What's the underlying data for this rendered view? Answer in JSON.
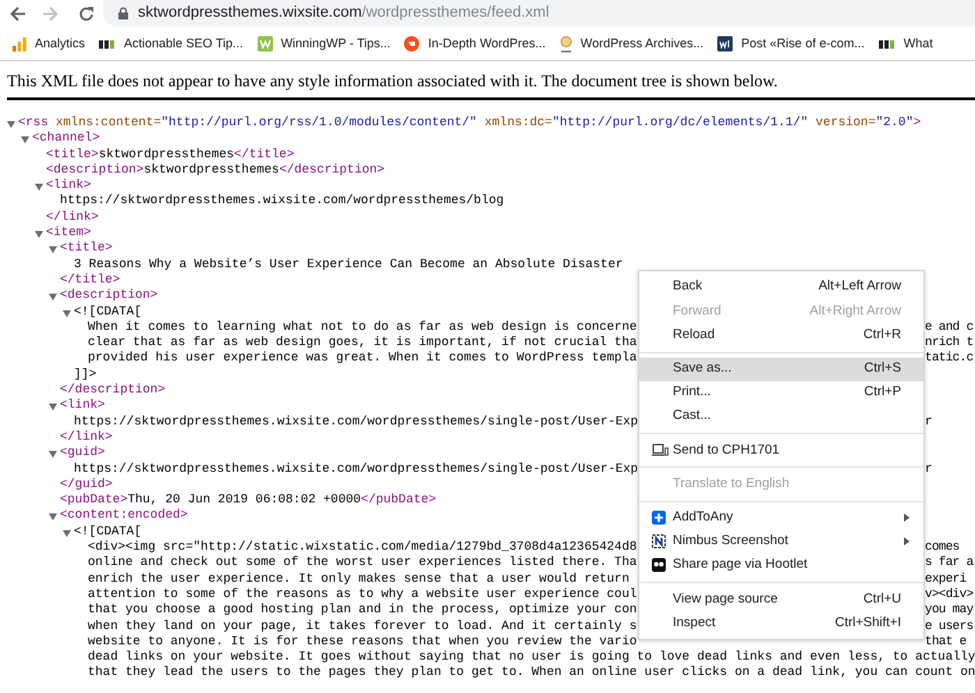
{
  "toolbar": {
    "url_host": "sktwordpressthemes.wixsite.com",
    "url_path": "/wordpressthemes/feed.xml",
    "forward_disabled": true
  },
  "bookmarks": [
    {
      "label": "Analytics",
      "kind": "bars"
    },
    {
      "label": "Actionable SEO Tip...",
      "kind": "sej"
    },
    {
      "label": "WinningWP - Tips...",
      "kind": "square-green"
    },
    {
      "label": "In-Depth WordPres...",
      "kind": "circle-orange"
    },
    {
      "label": "WordPress Archives...",
      "kind": "badge"
    },
    {
      "label": "Post «Rise of e-com...",
      "kind": "square-navy"
    },
    {
      "label": "What",
      "kind": "sej"
    }
  ],
  "notice": "This XML file does not appear to have any style information associated with it. The document tree is shown below.",
  "tree": [
    {
      "expanded": true,
      "parts": [
        {
          "kind": "tag",
          "text": "<rss"
        },
        {
          "kind": "attr",
          "text": " xmlns:content="
        },
        {
          "kind": "value",
          "text": "\"http://purl.org/rss/1.0/modules/content/\""
        },
        {
          "kind": "attr",
          "text": " xmlns:dc="
        },
        {
          "kind": "value",
          "text": "\"http://purl.org/dc/elements/1.1/\""
        },
        {
          "kind": "attr",
          "text": " version="
        },
        {
          "kind": "value",
          "text": "\"2.0\""
        },
        {
          "kind": "tag",
          "text": ">"
        }
      ],
      "children": [
        {
          "expanded": true,
          "parts": [
            {
              "kind": "tag",
              "text": "<channel>"
            }
          ],
          "children": [
            {
              "parts": [
                {
                  "kind": "tag",
                  "text": "<title>"
                },
                {
                  "kind": "text",
                  "text": "sktwordpressthemes"
                },
                {
                  "kind": "tag",
                  "text": "</title>"
                }
              ]
            },
            {
              "parts": [
                {
                  "kind": "tag",
                  "text": "<description>"
                },
                {
                  "kind": "text",
                  "text": "sktwordpressthemes"
                },
                {
                  "kind": "tag",
                  "text": "</description>"
                }
              ]
            },
            {
              "expanded": true,
              "parts": [
                {
                  "kind": "tag",
                  "text": "<link>"
                }
              ],
              "close": "</link>",
              "children": [
                {
                  "parts": [
                    {
                      "kind": "text",
                      "text": "https://sktwordpressthemes.wixsite.com/wordpressthemes/blog"
                    }
                  ]
                }
              ]
            },
            {
              "expanded": true,
              "parts": [
                {
                  "kind": "tag",
                  "text": "<item>"
                }
              ],
              "children": [
                {
                  "expanded": true,
                  "parts": [
                    {
                      "kind": "tag",
                      "text": "<title>"
                    }
                  ],
                  "close": "</title>",
                  "children": [
                    {
                      "parts": [
                        {
                          "kind": "text",
                          "text": "3 Reasons Why a Website’s User Experience Can Become an Absolute Disaster"
                        }
                      ]
                    }
                  ]
                },
                {
                  "expanded": true,
                  "parts": [
                    {
                      "kind": "tag",
                      "text": "<description>"
                    }
                  ],
                  "close": "</description>",
                  "children": [
                    {
                      "expanded": true,
                      "parts": [
                        {
                          "kind": "text",
                          "text": "<![CDATA["
                        }
                      ],
                      "close": "]]>",
                      "children": [
                        {
                          "parts": [
                            {
                              "kind": "text",
                              "text": "When it comes to learning what not to do as far as web design is concerne"
                            }
                          ],
                          "right": "e and c"
                        },
                        {
                          "parts": [
                            {
                              "kind": "text",
                              "text": "clear that as far as web design goes, it is important, if not crucial tha"
                            }
                          ],
                          "right": "nrich t"
                        },
                        {
                          "parts": [
                            {
                              "kind": "text",
                              "text": "provided his user experience was great. When it comes to WordPress templa"
                            }
                          ],
                          "right": "tatic.c"
                        }
                      ]
                    }
                  ]
                },
                {
                  "expanded": true,
                  "parts": [
                    {
                      "kind": "tag",
                      "text": "<link>"
                    }
                  ],
                  "close": "</link>",
                  "children": [
                    {
                      "parts": [
                        {
                          "kind": "text",
                          "text": "https://sktwordpressthemes.wixsite.com/wordpressthemes/single-post/User-Exp"
                        }
                      ],
                      "right": "r"
                    }
                  ]
                },
                {
                  "expanded": true,
                  "parts": [
                    {
                      "kind": "tag",
                      "text": "<guid>"
                    }
                  ],
                  "close": "</guid>",
                  "children": [
                    {
                      "parts": [
                        {
                          "kind": "text",
                          "text": "https://sktwordpressthemes.wixsite.com/wordpressthemes/single-post/User-Exp"
                        }
                      ],
                      "right": "r"
                    }
                  ]
                },
                {
                  "parts": [
                    {
                      "kind": "tag",
                      "text": "<pubDate>"
                    },
                    {
                      "kind": "text",
                      "text": "Thu, 20 Jun 2019 06:08:02 +0000"
                    },
                    {
                      "kind": "tag",
                      "text": "</pubDate>"
                    }
                  ]
                },
                {
                  "expanded": true,
                  "parts": [
                    {
                      "kind": "tag",
                      "text": "<content:encoded>"
                    }
                  ],
                  "children": [
                    {
                      "expanded": true,
                      "parts": [
                        {
                          "kind": "text",
                          "text": "<![CDATA["
                        }
                      ],
                      "children": [
                        {
                          "parts": [
                            {
                              "kind": "text",
                              "text": "<div><img src=\"http://static.wixstatic.com/media/1279bd_3708d4a12365424d8"
                            }
                          ],
                          "right": "comes"
                        },
                        {
                          "parts": [
                            {
                              "kind": "text",
                              "text": "online and check out some of the worst user experiences listed there. Tha"
                            }
                          ],
                          "right": "s far a"
                        },
                        {
                          "parts": [
                            {
                              "kind": "text",
                              "text": "enrich the user experience. It only makes sense that a user would return"
                            }
                          ],
                          "right": "experi"
                        },
                        {
                          "parts": [
                            {
                              "kind": "text",
                              "text": "attention to some of the reasons as to why a website user experience coul"
                            }
                          ],
                          "right": "v><div>"
                        },
                        {
                          "parts": [
                            {
                              "kind": "text",
                              "text": "that you choose a good hosting plan and in the process, optimize your con"
                            }
                          ],
                          "right": "you may"
                        },
                        {
                          "parts": [
                            {
                              "kind": "text",
                              "text": "when they land on your page, it takes forever to load. And it certainly s"
                            }
                          ],
                          "right": "e users"
                        },
                        {
                          "parts": [
                            {
                              "kind": "text",
                              "text": "website to anyone. It is for these reasons that when you review the vario"
                            }
                          ],
                          "right": "that e"
                        },
                        {
                          "parts": [
                            {
                              "kind": "text",
                              "text": "dead links on your website. It goes without saying that no user is going to love dead links and even less, to actually"
                            }
                          ]
                        },
                        {
                          "parts": [
                            {
                              "kind": "text",
                              "text": "that they lead the users to the pages they plan to get to. When an online user clicks on a dead link, you can count on"
                            }
                          ]
                        }
                      ]
                    }
                  ]
                }
              ]
            }
          ]
        }
      ]
    }
  ],
  "context_menu": [
    [
      {
        "label": "Back",
        "shortcut": "Alt+Left Arrow",
        "disabled": false,
        "selected": false
      },
      {
        "label": "Forward",
        "shortcut": "Alt+Right Arrow",
        "disabled": true,
        "selected": false
      },
      {
        "label": "Reload",
        "shortcut": "Ctrl+R",
        "disabled": false,
        "selected": false
      }
    ],
    [
      {
        "label": "Save as...",
        "shortcut": "Ctrl+S",
        "disabled": false,
        "selected": true
      },
      {
        "label": "Print...",
        "shortcut": "Ctrl+P",
        "disabled": false,
        "selected": false
      },
      {
        "label": "Cast...",
        "disabled": false,
        "selected": false
      }
    ],
    [
      {
        "label": "Send to CPH1701",
        "kind": "device",
        "disabled": false,
        "selected": false
      }
    ],
    [
      {
        "label": "Translate to English",
        "disabled": true,
        "selected": false
      }
    ],
    [
      {
        "label": "AddToAny",
        "kind": "share",
        "submenu": true,
        "disabled": false,
        "selected": false
      },
      {
        "label": "Nimbus Screenshot",
        "kind": "capture",
        "submenu": true,
        "disabled": false,
        "selected": false
      },
      {
        "label": "Share page via Hootlet",
        "kind": "owl",
        "disabled": false,
        "selected": false
      }
    ],
    [
      {
        "label": "View page source",
        "shortcut": "Ctrl+U",
        "disabled": false,
        "selected": false
      },
      {
        "label": "Inspect",
        "shortcut": "Ctrl+Shift+I",
        "disabled": false,
        "selected": false
      }
    ]
  ]
}
